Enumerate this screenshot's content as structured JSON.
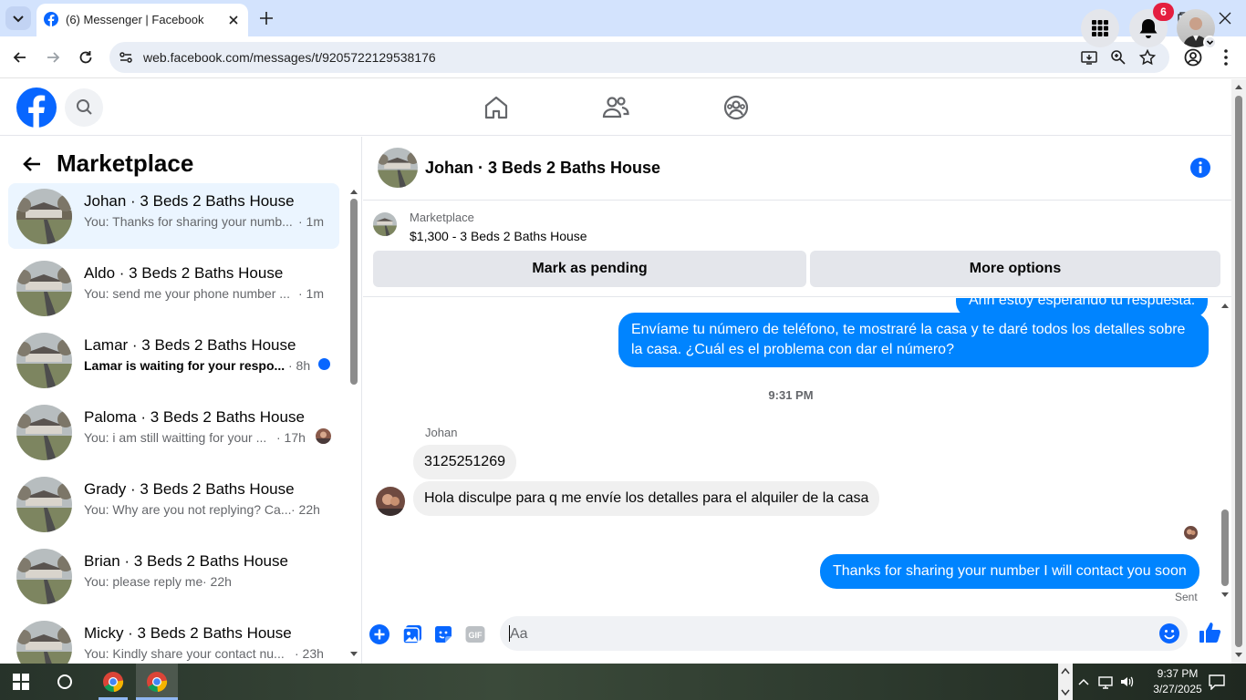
{
  "browser": {
    "tab_title": "(6) Messenger | Facebook",
    "url": "web.facebook.com/messages/t/9205722129538176"
  },
  "header": {
    "notifications_badge": "6"
  },
  "sidebar": {
    "heading": "Marketplace",
    "conversations": [
      {
        "name": "Johan · 3 Beds 2 Baths House",
        "preview": "You: Thanks for sharing your numb...",
        "time": "· 1m"
      },
      {
        "name": "Aldo · 3 Beds 2 Baths House",
        "preview": "You: send me your phone number ...",
        "time": "· 1m"
      },
      {
        "name": "Lamar · 3 Beds 2 Baths House",
        "preview": "Lamar is waiting for your respo...",
        "time": "· 8h"
      },
      {
        "name": "Paloma · 3 Beds 2 Baths House",
        "preview": "You: i am still waitting for your ...",
        "time": "· 17h"
      },
      {
        "name": "Grady · 3 Beds 2 Baths House",
        "preview": "You: Why are you not replying? Ca...",
        "time": "· 22h"
      },
      {
        "name": "Brian · 3 Beds 2 Baths House",
        "preview": "You: please reply me",
        "time": "· 22h"
      },
      {
        "name": "Micky · 3 Beds 2 Baths House",
        "preview": "You: Kindly share your contact nu...",
        "time": "· 23h"
      }
    ]
  },
  "chat": {
    "title": "Johan · 3 Beds 2 Baths House",
    "listing_label": "Marketplace",
    "listing_price": "$1,300 - 3 Beds 2 Baths House",
    "mark_pending_label": "Mark as pending",
    "more_options_label": "More options",
    "partial_message": "Ahh estoy esperando tu respuesta.",
    "out_message_1": "Envíame tu número de teléfono, te mostraré la casa y te daré todos los detalles sobre la casa. ¿Cuál es el problema con dar el número?",
    "timestamp": "9:31 PM",
    "sender_name": "Johan",
    "in_message_1": "3125251269",
    "in_message_2": "Hola disculpe para q me envíe los detalles para el alquiler de la casa",
    "out_message_2": "Thanks for sharing your number I will contact you soon",
    "status": "Sent",
    "composer_placeholder": "Aa"
  },
  "taskbar": {
    "time": "9:37 PM",
    "date": "3/27/2025"
  }
}
